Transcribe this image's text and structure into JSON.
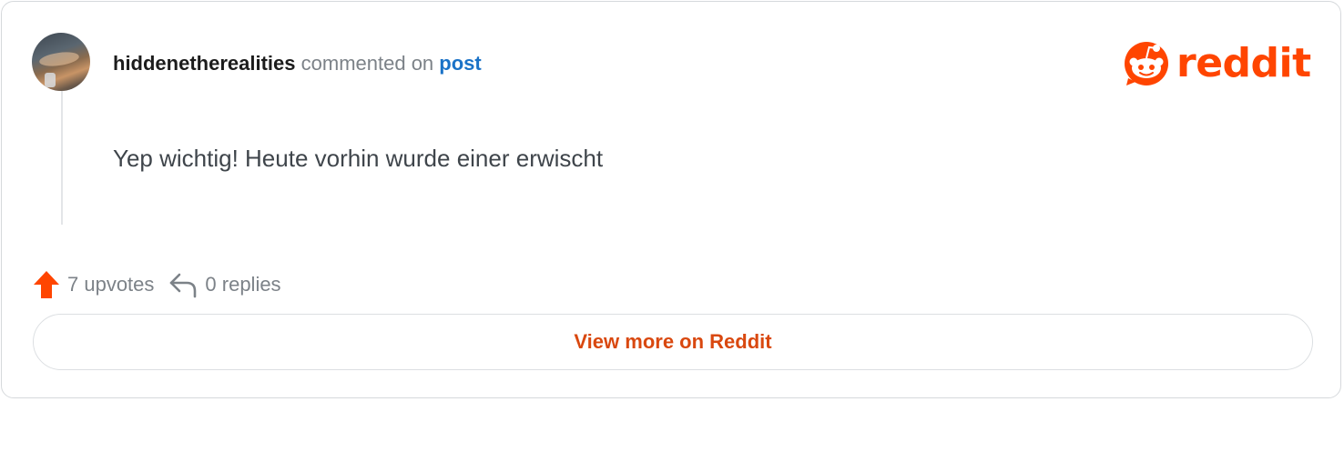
{
  "comment": {
    "username": "hiddenetherealities",
    "action_text": "commented on",
    "post_link_text": "post",
    "body": "Yep wichtig! Heute vorhin wurde einer erwischt"
  },
  "logo": {
    "text": "reddit",
    "icon": "reddit-snoo-icon"
  },
  "stats": {
    "upvotes_label": "7 upvotes",
    "upvote_icon": "upvote-arrow-icon",
    "replies_label": "0 replies",
    "reply_icon": "reply-arrow-icon"
  },
  "actions": {
    "view_more_label": "View more on Reddit"
  },
  "colors": {
    "brand_orange": "#ff4500",
    "link_blue": "#1a72c7",
    "cta_orange": "#d9480f",
    "muted_text": "#7c8288",
    "body_text": "#3f454b"
  }
}
